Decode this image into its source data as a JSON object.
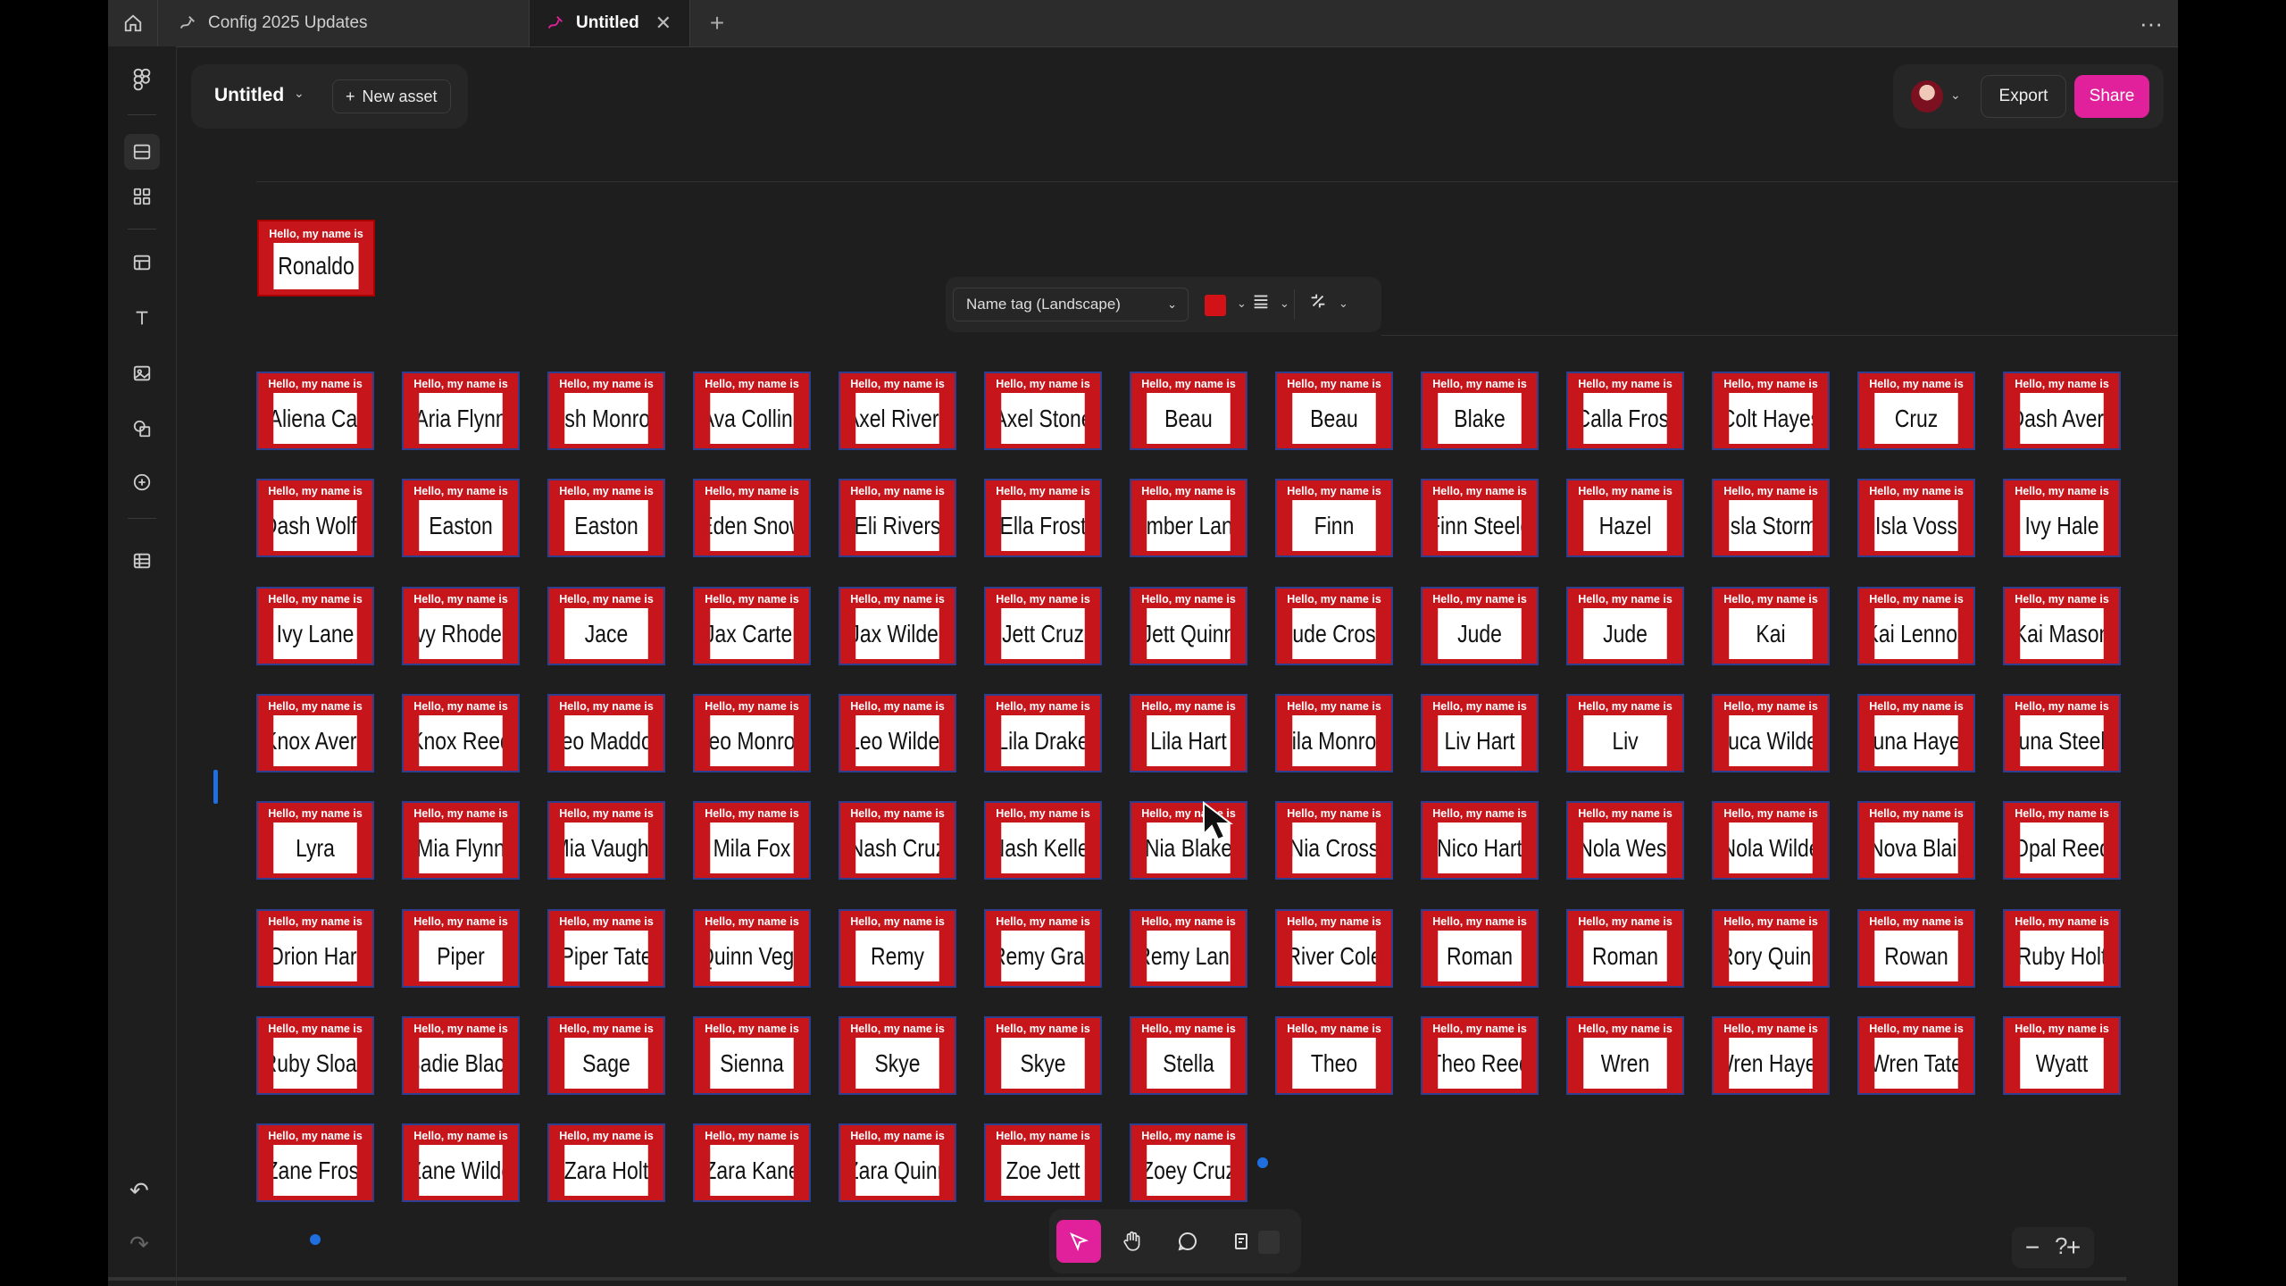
{
  "tabs": {
    "file_tab_label": "Config 2025 Updates",
    "active_tab_label": "Untitled",
    "close_glyph": "✕",
    "plus_glyph": "+",
    "more_glyph": "···"
  },
  "doc": {
    "title": "Untitled",
    "new_asset_label": "New asset"
  },
  "header": {
    "export_label": "Export",
    "share_label": "Share"
  },
  "sample_tag": {
    "hello": "Hello, my name is",
    "name": "Ronaldo"
  },
  "toolbar": {
    "template_select": "Name tag (Landscape)",
    "fill_color": "#d21216"
  },
  "colors": {
    "accent": "#e1219c",
    "tag_red": "#c7151c",
    "selection_blue": "#2f3f8f"
  },
  "tag_label": "Hello, my name is",
  "names": [
    "Aliena Cai",
    "Aria Flynn",
    "Ash Monroe",
    "Ava Collins",
    "Axel Rivers",
    "Axel Stone",
    "Beau",
    "Beau",
    "Blake",
    "Calla Frost",
    "Colt Hayes",
    "Cruz",
    "Dash Avery",
    "Dash Wolfe",
    "Easton",
    "Easton",
    "Eden Snow",
    "Eli Rivers",
    "Ella Frost",
    "Ember Lane",
    "Finn",
    "Finn Steele",
    "Hazel",
    "Isla Storm",
    "Isla Voss",
    "Ivy Hale",
    "Ivy Lane",
    "Ivy Rhodes",
    "Jace",
    "Jax Carter",
    "Jax Wilder",
    "Jett Cruz",
    "Jett Quinn",
    "Jude Cross",
    "Jude",
    "Jude",
    "Kai",
    "Kai Lennox",
    "Kai Mason",
    "Knox Avery",
    "Knox Reed",
    "Leo Maddox",
    "Leo Monroe",
    "Leo Wilder",
    "Lila Drake",
    "Lila Hart",
    "Lila Monroe",
    "Liv Hart",
    "Liv",
    "Luca Wilder",
    "Luna Hayes",
    "Luna Steele",
    "Lyra",
    "Mia Flynn",
    "Mia Vaughn",
    "Mila Fox",
    "Nash Cruz",
    "Nash Keller",
    "Nia Blake",
    "Nia Cross",
    "Nico Hart",
    "Nola West",
    "Nola Wilde",
    "Nova Blair",
    "Opal Reed",
    "Orion Hart",
    "Piper",
    "Piper Tate",
    "Quinn Vega",
    "Remy",
    "Remy Gray",
    "Remy Lane",
    "River Cole",
    "Roman",
    "Roman",
    "Rory Quinn",
    "Rowan",
    "Ruby Holt",
    "Ruby Sloan",
    "Sadie Black",
    "Sage",
    "Sienna",
    "Skye",
    "Skye",
    "Stella",
    "Theo",
    "Theo Reed",
    "Wren",
    "Wren Hayes",
    "Wren Tate",
    "Wyatt",
    "Zane Frost",
    "Zane Wilde",
    "Zara Holt",
    "Zara Kane",
    "Zara Quinn",
    "Zoe Jett",
    "Zoey Cruz"
  ]
}
